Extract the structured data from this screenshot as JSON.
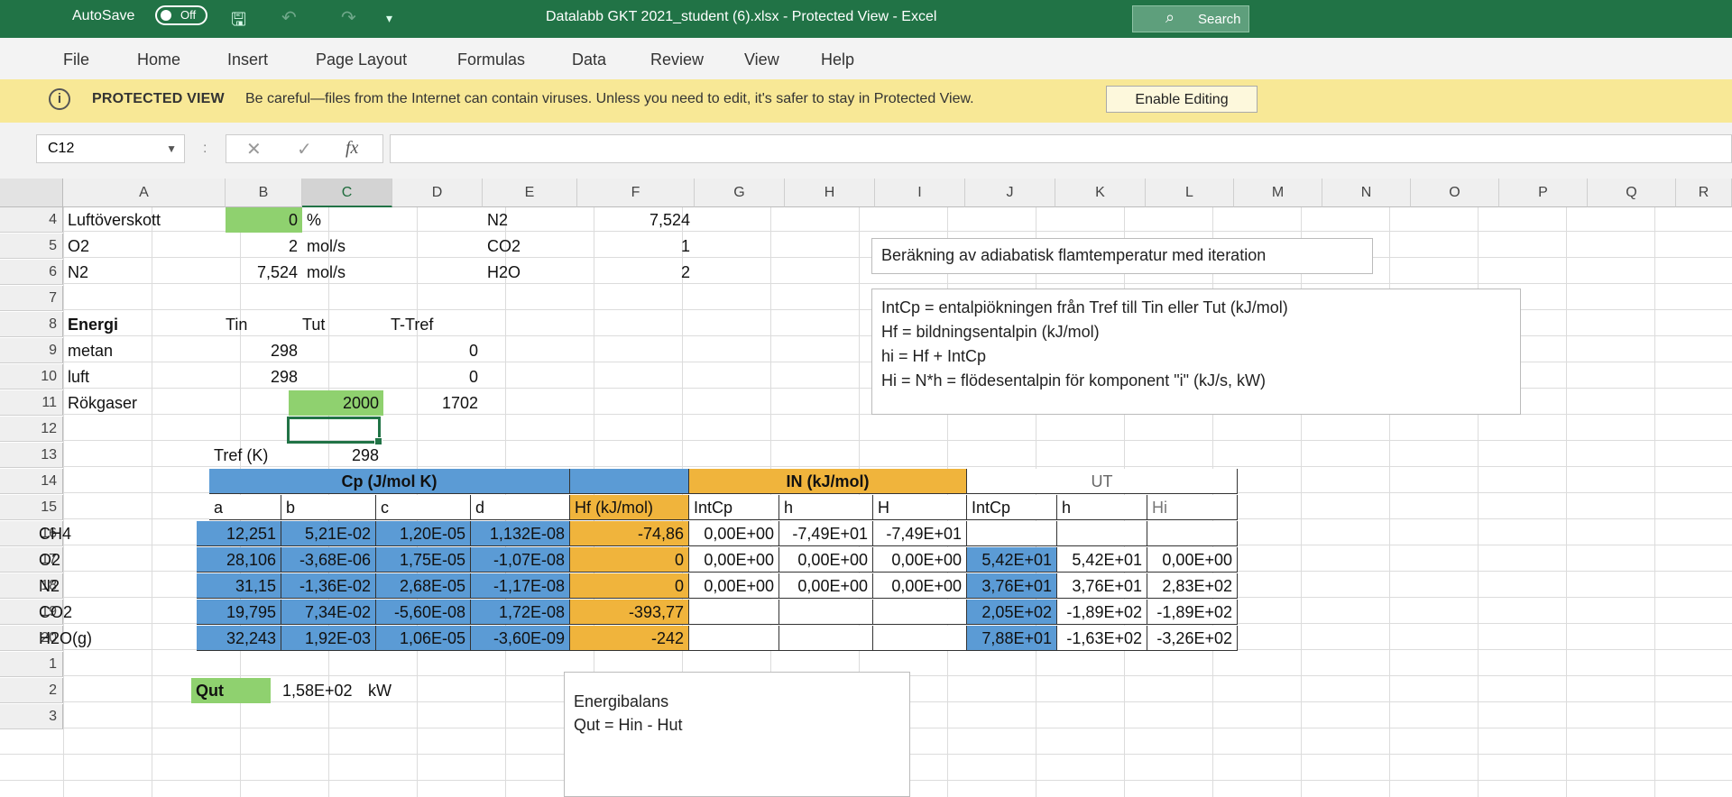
{
  "titlebar": {
    "autosave_label": "AutoSave",
    "autosave_state": "Off",
    "document_title": "Datalabb GKT 2021_student (6).xlsx  -  Protected View  -  Excel",
    "search_placeholder": "Search"
  },
  "ribbon_tabs": [
    "File",
    "Home",
    "Insert",
    "Page Layout",
    "Formulas",
    "Data",
    "Review",
    "View",
    "Help"
  ],
  "protected_view": {
    "title": "PROTECTED VIEW",
    "message": "Be careful—files from the Internet can contain viruses. Unless you need to edit, it's safer to stay in Protected View.",
    "button": "Enable Editing"
  },
  "formula_bar": {
    "name_box": "C12",
    "separator": ":",
    "cancel": "✕",
    "enter": "✓",
    "fx": "fx",
    "content": ""
  },
  "columns": [
    "A",
    "B",
    "C",
    "D",
    "E",
    "F",
    "G",
    "H",
    "I",
    "J",
    "K",
    "L",
    "M",
    "N",
    "O",
    "P",
    "Q",
    "R"
  ],
  "rows": [
    "4",
    "5",
    "6",
    "7",
    "8",
    "9",
    "10",
    "11",
    "12",
    "13",
    "14",
    "15",
    "16",
    "17",
    "18",
    "19",
    "20",
    "1",
    "2",
    "3"
  ],
  "cells": {
    "a4": "Luftöverskott",
    "b4": "0",
    "c4": "%",
    "e4": "N2",
    "f4": "7,524",
    "a5": "O2",
    "b5": "2",
    "c5": "mol/s",
    "e5": "CO2",
    "f5": "1",
    "a6": "N2",
    "b6": "7,524",
    "c6": "mol/s",
    "e6": "H2O",
    "f6": "2",
    "a8": "Energi",
    "b8": "Tin",
    "c8": "Tut",
    "d8": "T-Tref",
    "a9": "metan",
    "b9": "298",
    "d9": "0",
    "a10": "luft",
    "b10": "298",
    "d10": "0",
    "a11": "Rökgaser",
    "c11": "2000",
    "d11": "1702",
    "b13": "Tref (K)",
    "c13": "298",
    "cp_header": "Cp (J/mol K)",
    "in_header": "IN (kJ/mol)",
    "ut_header": "UT",
    "h15": [
      "a",
      "b",
      "c",
      "d",
      "Hf (kJ/mol)",
      "IntCp",
      "h",
      "H",
      "IntCp",
      "h",
      "Hi"
    ],
    "rows16_20": [
      {
        "name": "CH4",
        "a": "12,251",
        "b": "5,21E-02",
        "c": "1,20E-05",
        "d": "1,132E-08",
        "hf": "-74,86",
        "in_intcp": "0,00E+00",
        "in_h": "-7,49E+01",
        "in_H": "-7,49E+01",
        "ut_intcp": "",
        "ut_h": "",
        "ut_hi": ""
      },
      {
        "name": "O2",
        "a": "28,106",
        "b": "-3,68E-06",
        "c": "1,75E-05",
        "d": "-1,07E-08",
        "hf": "0",
        "in_intcp": "0,00E+00",
        "in_h": "0,00E+00",
        "in_H": "0,00E+00",
        "ut_intcp": "5,42E+01",
        "ut_h": "5,42E+01",
        "ut_hi": "0,00E+00"
      },
      {
        "name": "N2",
        "a": "31,15",
        "b": "-1,36E-02",
        "c": "2,68E-05",
        "d": "-1,17E-08",
        "hf": "0",
        "in_intcp": "0,00E+00",
        "in_h": "0,00E+00",
        "in_H": "0,00E+00",
        "ut_intcp": "3,76E+01",
        "ut_h": "3,76E+01",
        "ut_hi": "2,83E+02"
      },
      {
        "name": "CO2",
        "a": "19,795",
        "b": "7,34E-02",
        "c": "-5,60E-08",
        "d": "1,72E-08",
        "hf": "-393,77",
        "in_intcp": "",
        "in_h": "",
        "in_H": "",
        "ut_intcp": "2,05E+02",
        "ut_h": "-1,89E+02",
        "ut_hi": "-1,89E+02"
      },
      {
        "name": "H2O(g)",
        "a": "32,243",
        "b": "1,92E-03",
        "c": "1,06E-05",
        "d": "-3,60E-09",
        "hf": "-242",
        "in_intcp": "",
        "in_h": "",
        "in_H": "",
        "ut_intcp": "7,88E+01",
        "ut_h": "-1,63E+02",
        "ut_hi": "-3,26E+02"
      }
    ],
    "qut_label": "Qut",
    "qut_value": "1,58E+02",
    "qut_unit": "kW"
  },
  "textboxes": {
    "title_box": "Beräkning av adiabatisk flamtemperatur med iteration",
    "definitions": [
      "IntCp = entalpiökningen från Tref till Tin eller Tut (kJ/mol)",
      "Hf = bildningsentalpin (kJ/mol)",
      "hi = Hf + IntCp",
      "Hi = N*h = flödesentalpin för komponent \"i\" (kJ/s, kW)"
    ],
    "energy_title": "Energibalans",
    "energy_eq": "Qut = Hin - Hut"
  },
  "colors": {
    "excel_green": "#217346",
    "table_blue": "#5b9bd5",
    "table_gold": "#f0b43c",
    "pv_yellow": "#f8e896",
    "input_green": "#8fd16f"
  }
}
